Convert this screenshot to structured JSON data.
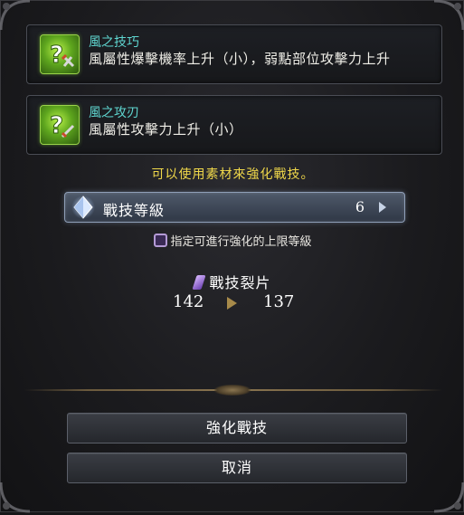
{
  "skills": [
    {
      "name": "風之技巧",
      "description": "風屬性爆擊機率上升（小），弱點部位攻擊力上升",
      "icon": "wind-skill-icon"
    },
    {
      "name": "風之攻刃",
      "description": "風屬性攻擊力上升（小）",
      "icon": "wind-skill-icon"
    }
  ],
  "hint": "可以使用素材來強化戰技。",
  "level": {
    "label": "戰技等級",
    "value": "6",
    "icon": "diamond-crystal-icon"
  },
  "limit_note": "指定可進行強化的上限等級",
  "material": {
    "name": "戰技裂片",
    "before": "142",
    "after": "137",
    "icon": "shard-icon"
  },
  "buttons": {
    "enhance": "強化戰技",
    "cancel": "取消"
  },
  "colors": {
    "skill_name": "#5fd6d0",
    "hint": "#f0d84a",
    "skill_icon": "#5ea61e"
  }
}
